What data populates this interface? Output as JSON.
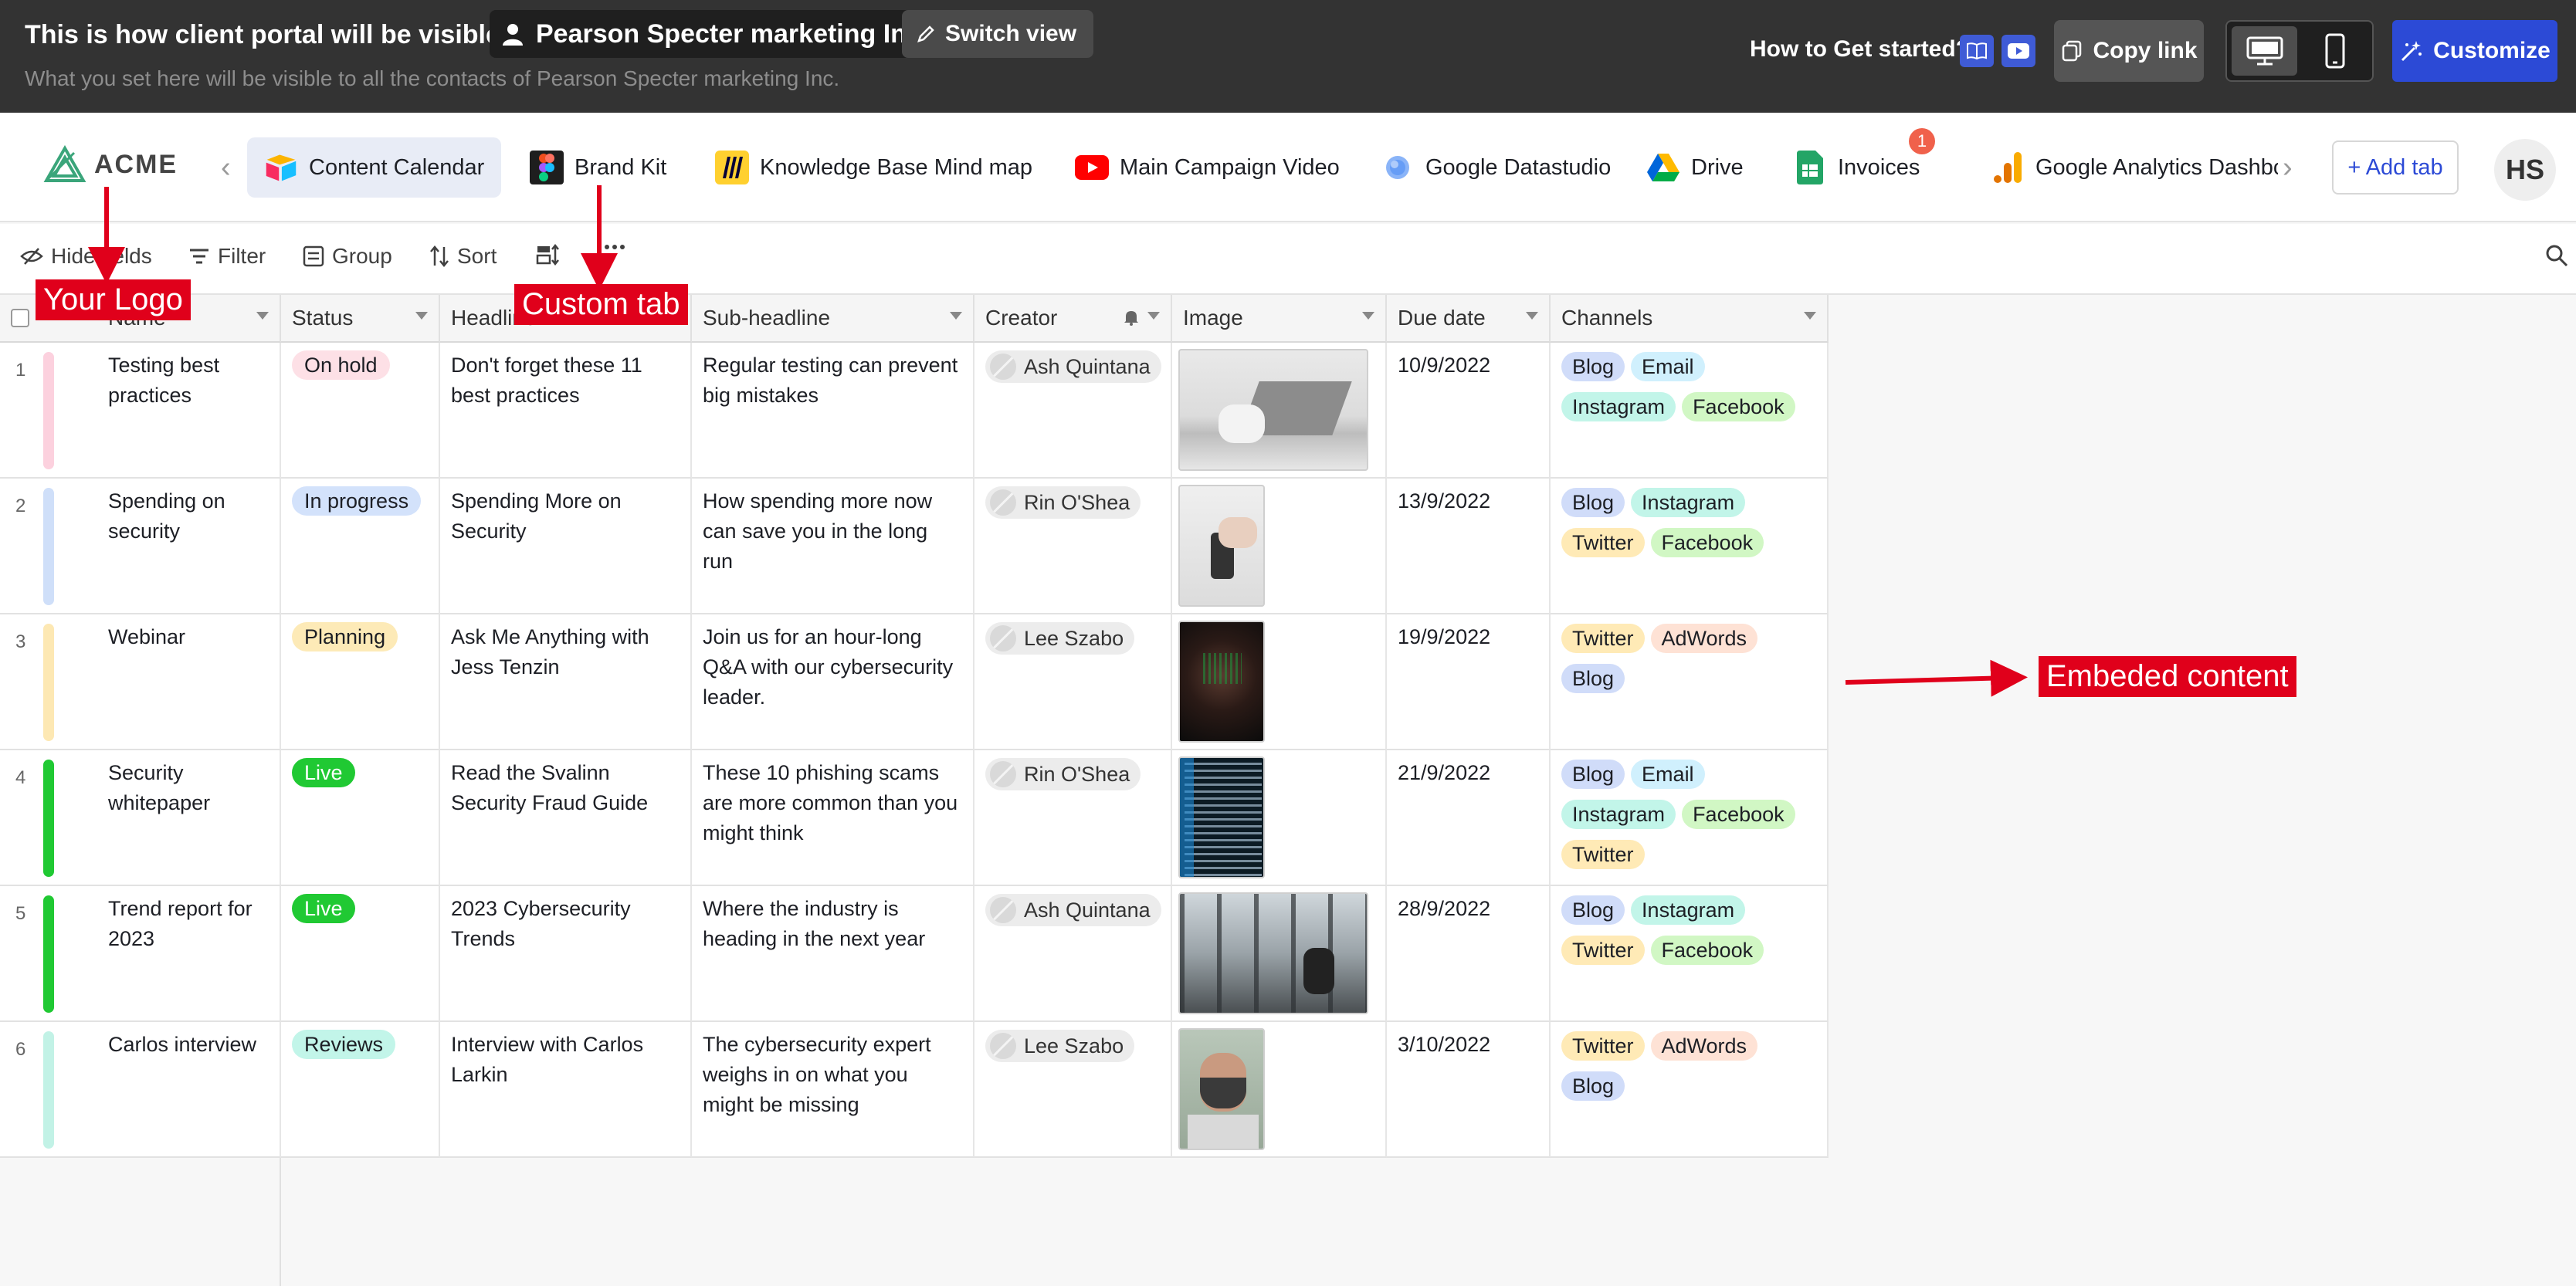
{
  "banner": {
    "title": "This is how client portal will be visible to",
    "client_name": "Pearson Specter marketing Inc",
    "switch_view": "Switch view",
    "subtitle": "What you set here will be visible to all the contacts of Pearson Specter marketing Inc.",
    "get_started": "How to Get started?",
    "copy_link": "Copy link",
    "customize": "Customize"
  },
  "logo": {
    "text": "ACME"
  },
  "tabs": [
    {
      "label": "Content Calendar",
      "icon": "airtable-icon"
    },
    {
      "label": "Brand Kit",
      "icon": "figma-icon"
    },
    {
      "label": "Knowledge Base Mind map",
      "icon": "miro-icon"
    },
    {
      "label": "Main Campaign Video",
      "icon": "youtube-icon"
    },
    {
      "label": "Google Datastudio",
      "icon": "datastudio-icon"
    },
    {
      "label": "Drive",
      "icon": "google-drive-icon"
    },
    {
      "label": "Invoices",
      "icon": "sheets-icon",
      "badge": "1"
    },
    {
      "label": "Google Analytics Dashbo",
      "icon": "analytics-icon"
    }
  ],
  "add_tab": "+ Add tab",
  "avatar_initials": "HS",
  "toolbar": {
    "hide_fields": "Hide fields",
    "filter": "Filter",
    "group": "Group",
    "sort": "Sort"
  },
  "columns": [
    "Name",
    "Status",
    "Headline",
    "Sub-headline",
    "Creator",
    "Image",
    "Due date",
    "Channels"
  ],
  "rows": [
    {
      "num": "1",
      "name": "Testing best practices",
      "status": "On hold",
      "headline": "Don't forget these 11 best practices",
      "sub": "Regular testing can prevent big mistakes",
      "creator": "Ash Quintana",
      "due": "10/9/2022",
      "channels": [
        "Blog",
        "Email",
        "Instagram",
        "Facebook"
      ]
    },
    {
      "num": "2",
      "name": "Spending on security",
      "status": "In progress",
      "headline": "Spending More on Security",
      "sub": "How spending more now can save you in the long run",
      "creator": "Rin O'Shea",
      "due": "13/9/2022",
      "channels": [
        "Blog",
        "Instagram",
        "Twitter",
        "Facebook"
      ]
    },
    {
      "num": "3",
      "name": "Webinar",
      "status": "Planning",
      "headline": "Ask Me Anything with Jess Tenzin",
      "sub": "Join us for an hour-long Q&A with our cybersecurity leader.",
      "creator": "Lee Szabo",
      "due": "19/9/2022",
      "channels": [
        "Twitter",
        "AdWords",
        "Blog"
      ]
    },
    {
      "num": "4",
      "name": "Security whitepaper",
      "status": "Live",
      "headline": "Read the Svalinn Security Fraud Guide",
      "sub": "These 10 phishing scams are more common than you might think",
      "creator": "Rin O'Shea",
      "due": "21/9/2022",
      "channels": [
        "Blog",
        "Email",
        "Instagram",
        "Facebook",
        "Twitter"
      ]
    },
    {
      "num": "5",
      "name": "Trend report for 2023",
      "status": "Live",
      "headline": "2023 Cybersecurity Trends",
      "sub": "Where the industry is heading in the next year",
      "creator": "Ash Quintana",
      "due": "28/9/2022",
      "channels": [
        "Blog",
        "Instagram",
        "Twitter",
        "Facebook"
      ]
    },
    {
      "num": "6",
      "name": "Carlos interview",
      "status": "Reviews",
      "headline": "Interview with Carlos Larkin",
      "sub": "The cybersecurity expert weighs in on what you might be missing",
      "creator": "Lee Szabo",
      "due": "3/10/2022",
      "channels": [
        "Twitter",
        "AdWords",
        "Blog"
      ]
    }
  ],
  "annotations": {
    "logo": "Your Logo",
    "tab": "Custom tab",
    "embed": "Embeded content"
  },
  "colors": {
    "banner_bg": "#333333",
    "accent": "#2c4ad6",
    "annotation": "#e0001b",
    "status": {
      "On hold": "#fde0e6",
      "In progress": "#d3e2fb",
      "Planning": "#fdeab7",
      "Live": "#20c933",
      "Reviews": "#c2f5e9"
    },
    "channel": {
      "Blog": "#d0dcf9",
      "Email": "#d0f0fd",
      "Instagram": "#c2f5e9",
      "Facebook": "#d1f7c4",
      "Twitter": "#ffeab6",
      "AdWords": "#fee2d5"
    },
    "row_bar": [
      "#fcd1de",
      "#cfdff9",
      "#fde8b3",
      "#20c933",
      "#20c933",
      "#c2f2e6"
    ]
  }
}
